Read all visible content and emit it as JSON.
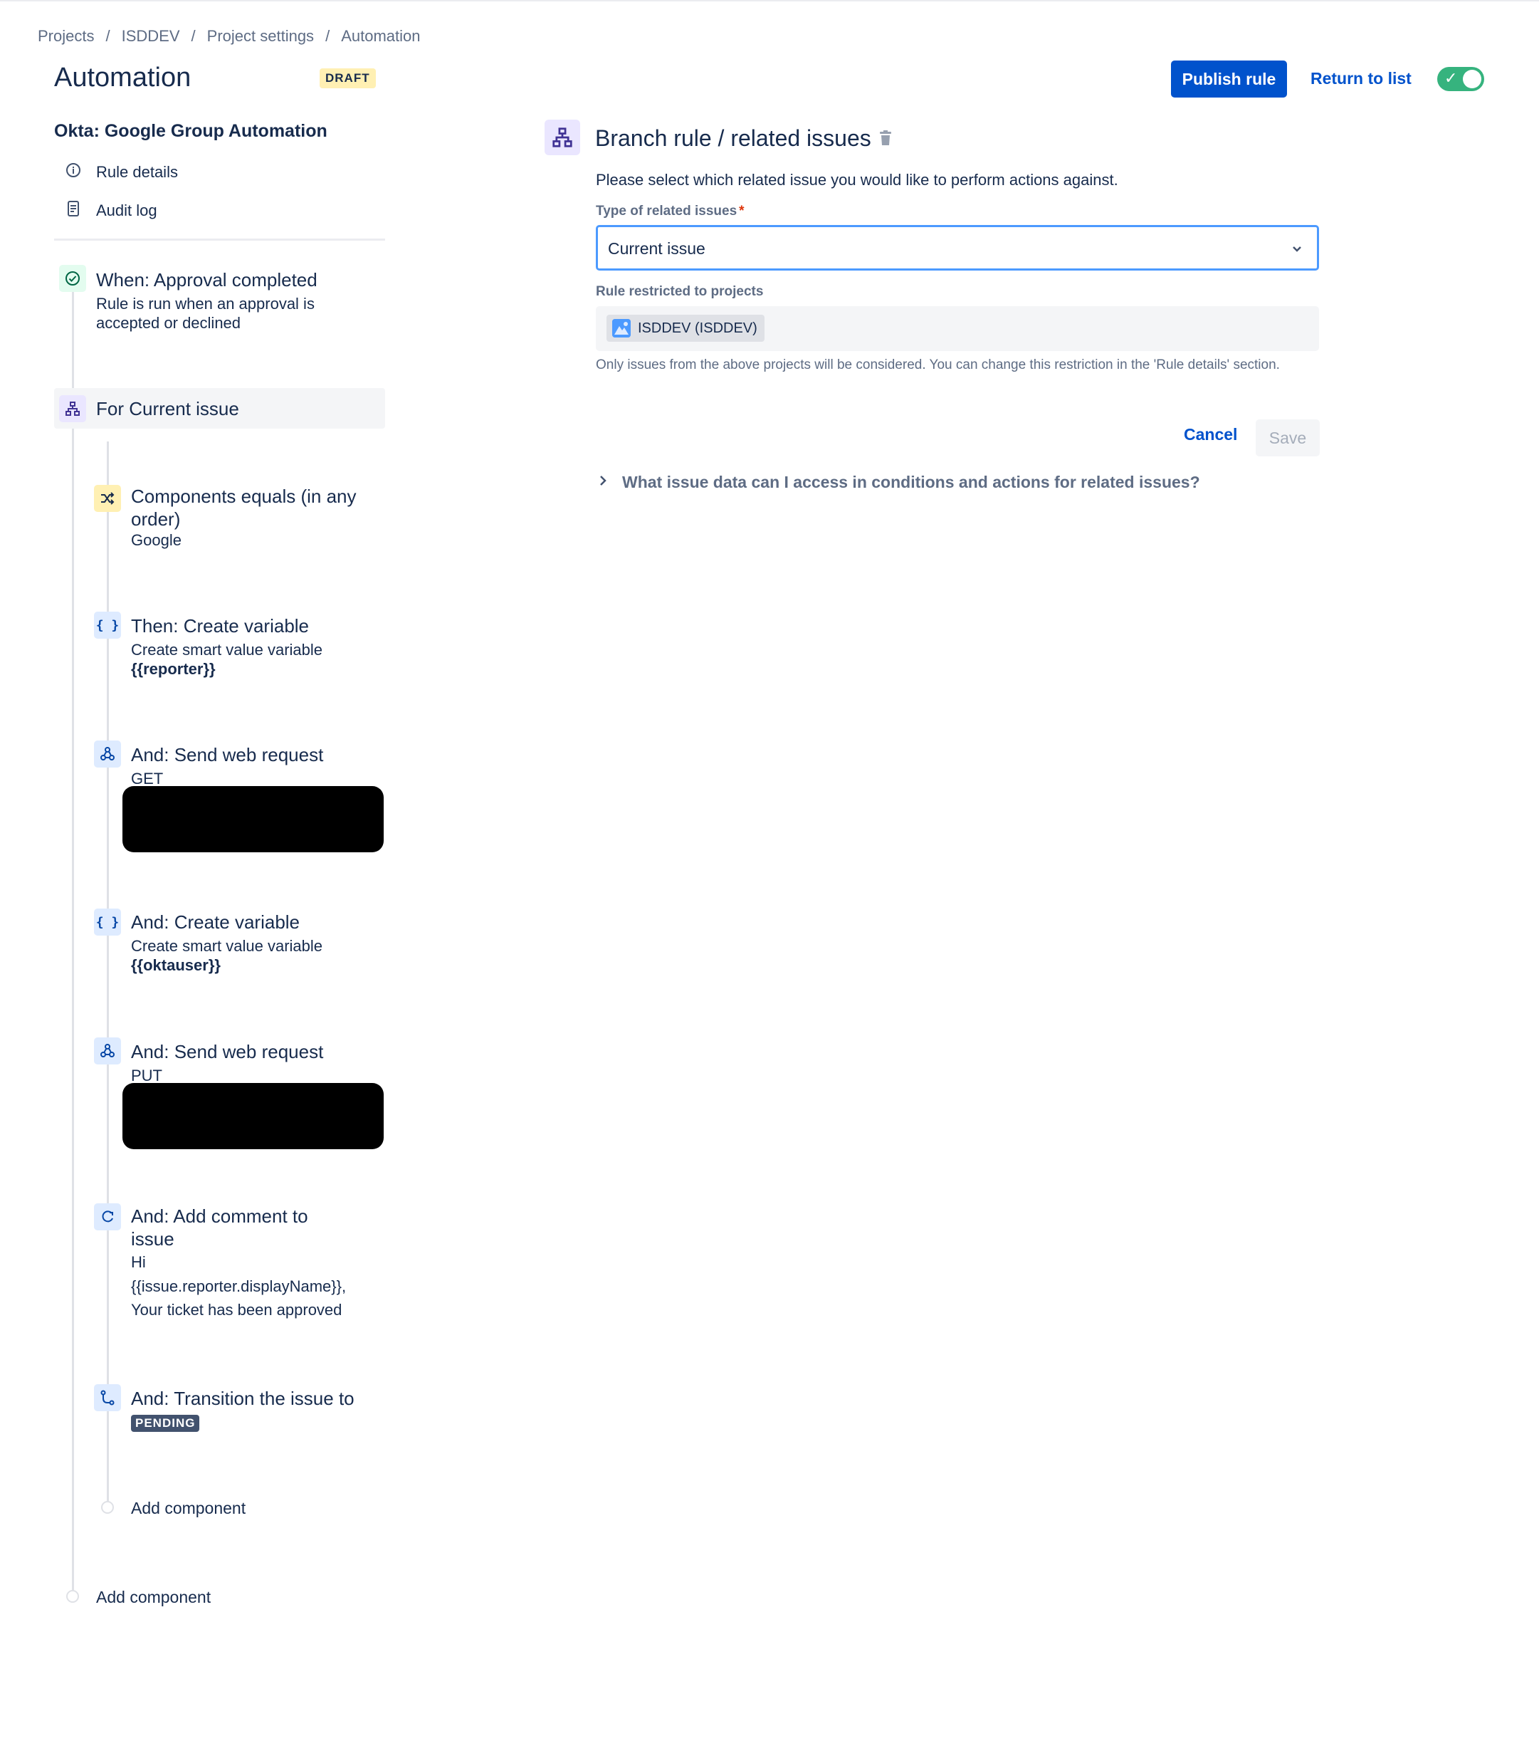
{
  "breadcrumbs": [
    "Projects",
    "ISDDEV",
    "Project settings",
    "Automation"
  ],
  "header": {
    "title": "Automation",
    "badge": "DRAFT",
    "publish_label": "Publish rule",
    "return_label": "Return to list",
    "rule_enabled": true
  },
  "sidebar": {
    "rule_name": "Okta: Google Group Automation",
    "links": [
      {
        "label": "Rule details",
        "icon": "info-icon"
      },
      {
        "label": "Audit log",
        "icon": "document-icon"
      }
    ]
  },
  "flow": {
    "trigger": {
      "title": "When: Approval completed",
      "desc_line1": "Rule is run when an approval is",
      "desc_line2": "accepted or declined",
      "icon": "check-circle-icon"
    },
    "branch": {
      "title": "For Current issue",
      "icon": "branch-icon"
    },
    "steps": [
      {
        "title_line1": "Components equals (in any",
        "title_line2": "order)",
        "sub": "Google",
        "icon": "shuffle-icon"
      },
      {
        "title": "Then: Create variable",
        "sub": "Create smart value variable",
        "sub_bold": "{{reporter}}",
        "icon": "braces-icon"
      },
      {
        "title": "And: Send web request",
        "sub": "GET",
        "icon": "webhook-icon"
      },
      {
        "title": "And: Create variable",
        "sub": "Create smart value variable",
        "sub_bold": "{{oktauser}}",
        "icon": "braces-icon"
      },
      {
        "title": "And: Send web request",
        "sub": "PUT",
        "icon": "webhook-icon"
      },
      {
        "title_line1": "And: Add comment to",
        "title_line2": "issue",
        "sub1": "Hi",
        "sub2": "{{issue.reporter.displayName}},",
        "sub3": "Your ticket has been approved",
        "icon": "comment-icon"
      },
      {
        "title": "And: Transition the issue to",
        "status": "PENDING",
        "icon": "transition-icon"
      }
    ],
    "add_component_inner": "Add component",
    "add_component_outer": "Add component"
  },
  "panel": {
    "title": "Branch rule / related issues",
    "description": "Please select which related issue you would like to perform actions against.",
    "type_label": "Type of related issues",
    "required_mark": "*",
    "type_value": "Current issue",
    "projects_label": "Rule restricted to projects",
    "project_tag": "ISDDEV (ISDDEV)",
    "helper_text": "Only issues from the above projects will be considered. You can change this restriction in the 'Rule details' section.",
    "cancel_label": "Cancel",
    "save_label": "Save",
    "faq": "What issue data can I access in conditions and actions for related issues?"
  }
}
